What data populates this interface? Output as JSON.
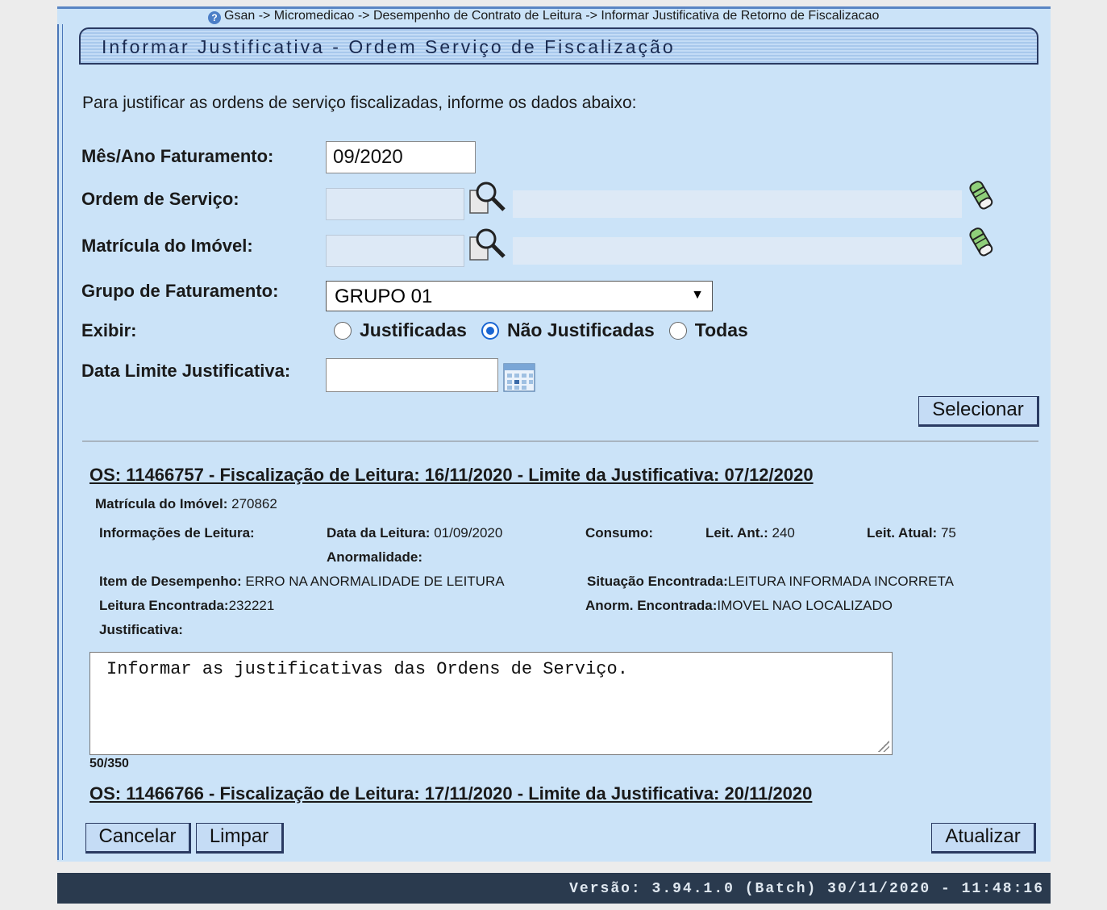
{
  "breadcrumb": "Gsan -> Micromedicao -> Desempenho de Contrato de Leitura -> Informar Justificativa de Retorno de Fiscalizacao",
  "title": "Informar Justificativa - Ordem Serviço de Fiscalização",
  "intro": "Para justificar as ordens de serviço fiscalizadas, informe os dados abaixo:",
  "form": {
    "mes_ano_label": "Mês/Ano Faturamento:",
    "mes_ano_value": "09/2020",
    "ordem_label": "Ordem de Serviço:",
    "matricula_label": "Matrícula do Imóvel:",
    "grupo_label": "Grupo de Faturamento:",
    "grupo_value": "GRUPO 01",
    "exibir_label": "Exibir:",
    "exibir_options": [
      "Justificadas",
      "Não Justificadas",
      "Todas"
    ],
    "exibir_selected": "Não Justificadas",
    "data_limite_label": "Data Limite Justificativa:",
    "data_limite_value": "",
    "selecionar_label": "Selecionar"
  },
  "os1": {
    "title": "OS: 11466757 - Fiscalização de Leitura: 16/11/2020 - Limite da Justificativa: 07/12/2020",
    "matricula_label": "Matrícula do Imóvel:",
    "matricula_value": "270862",
    "info_leitura_label": "Informações de Leitura:",
    "data_leitura_label": "Data da Leitura:",
    "data_leitura_value": "01/09/2020",
    "anormalidade_label": "Anormalidade:",
    "consumo_label": "Consumo:",
    "leit_ant_label": "Leit. Ant.:",
    "leit_ant_value": "240",
    "leit_atual_label": "Leit. Atual:",
    "leit_atual_value": "75",
    "item_label": "Item de Desempenho:",
    "item_value": "ERRO NA ANORMALIDADE DE LEITURA",
    "situacao_label": "Situação Encontrada:",
    "situacao_value": "LEITURA INFORMADA INCORRETA",
    "leitura_enc_label": "Leitura Encontrada:",
    "leitura_enc_value": "232221",
    "anorm_enc_label": "Anorm. Encontrada:",
    "anorm_enc_value": "IMOVEL NAO LOCALIZADO",
    "justificativa_label": "Justificativa:",
    "justificativa_value": "Informar as justificativas das Ordens de Serviço.",
    "counter": "50/350"
  },
  "os2": {
    "title": "OS: 11466766 - Fiscalização de Leitura: 17/11/2020 - Limite da Justificativa: 20/11/2020"
  },
  "buttons": {
    "cancelar": "Cancelar",
    "limpar": "Limpar",
    "atualizar": "Atualizar"
  },
  "footer": "Versão: 3.94.1.0 (Batch) 30/11/2020 - 11:48:16"
}
